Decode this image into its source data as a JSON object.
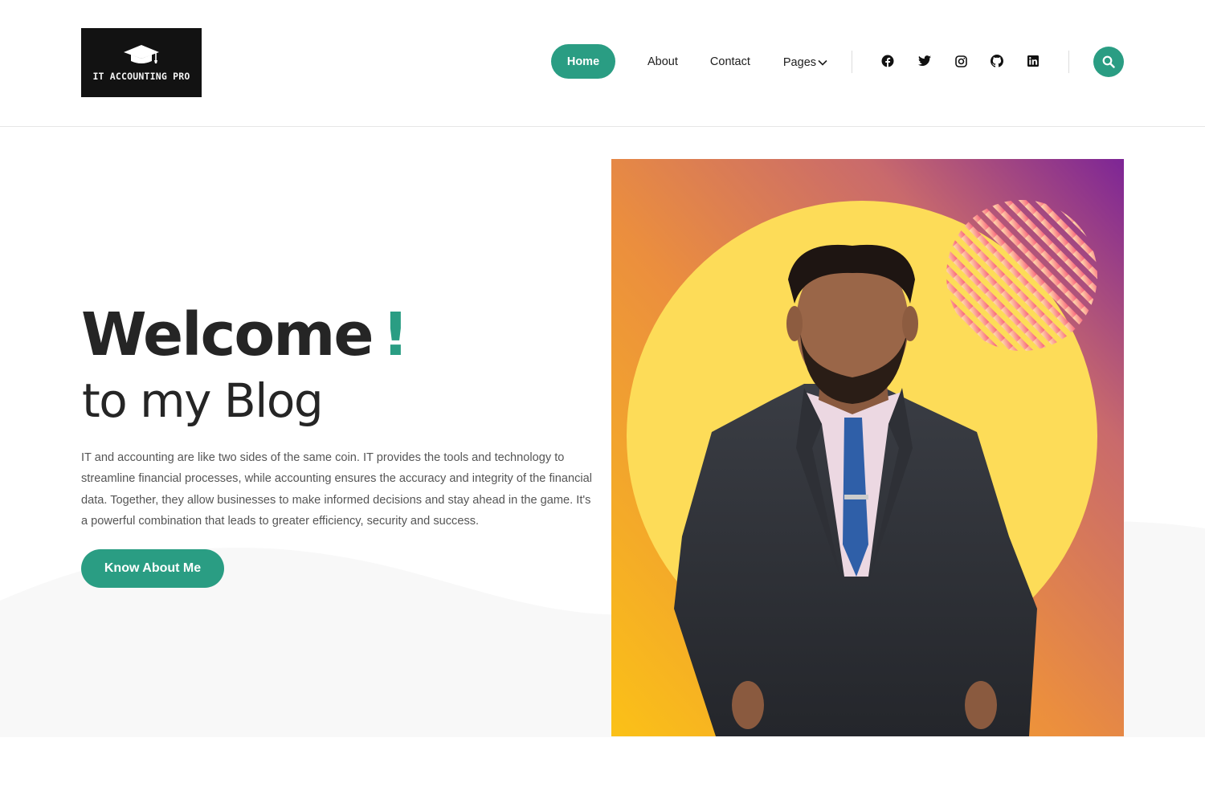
{
  "brand": {
    "logo_text": "IT ACCOUNTING PRO",
    "accent_color": "#2a9d83"
  },
  "nav": {
    "home": "Home",
    "about": "About",
    "contact": "Contact",
    "pages": "Pages"
  },
  "social": [
    "facebook-icon",
    "twitter-icon",
    "instagram-icon",
    "github-icon",
    "linkedin-icon"
  ],
  "hero": {
    "title": "Welcome",
    "title_mark": "!",
    "subtitle": "to my Blog",
    "paragraph": "IT and accounting are like two sides of the same coin. IT provides the tools and technology to streamline financial processes, while accounting ensures the accuracy and integrity of the financial data. Together, they allow businesses to make informed decisions and stay ahead in the game. It's a powerful combination that leads to greater efficiency, security and success.",
    "cta": "Know About Me"
  }
}
